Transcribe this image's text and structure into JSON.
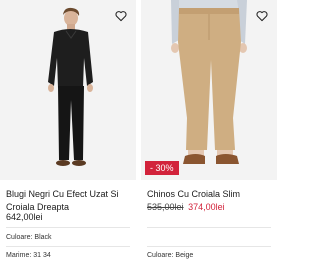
{
  "products": [
    {
      "title": "Blugi Negri Cu Efect Uzat Si Croiala Dreapta",
      "price": "642,00lei",
      "color_label": "Culoare: Black",
      "size_label": "Marime: 31 34"
    },
    {
      "title": "Chinos Cu Croiala Slim",
      "discount": "- 30%",
      "old_price": "535,00lei",
      "new_price": "374,00lei",
      "color_label": "Culoare: Beige"
    }
  ],
  "icons": {
    "wishlist": "heart-icon"
  },
  "colors": {
    "sale": "#d2233b",
    "card_bg": "#f3f3f3"
  }
}
